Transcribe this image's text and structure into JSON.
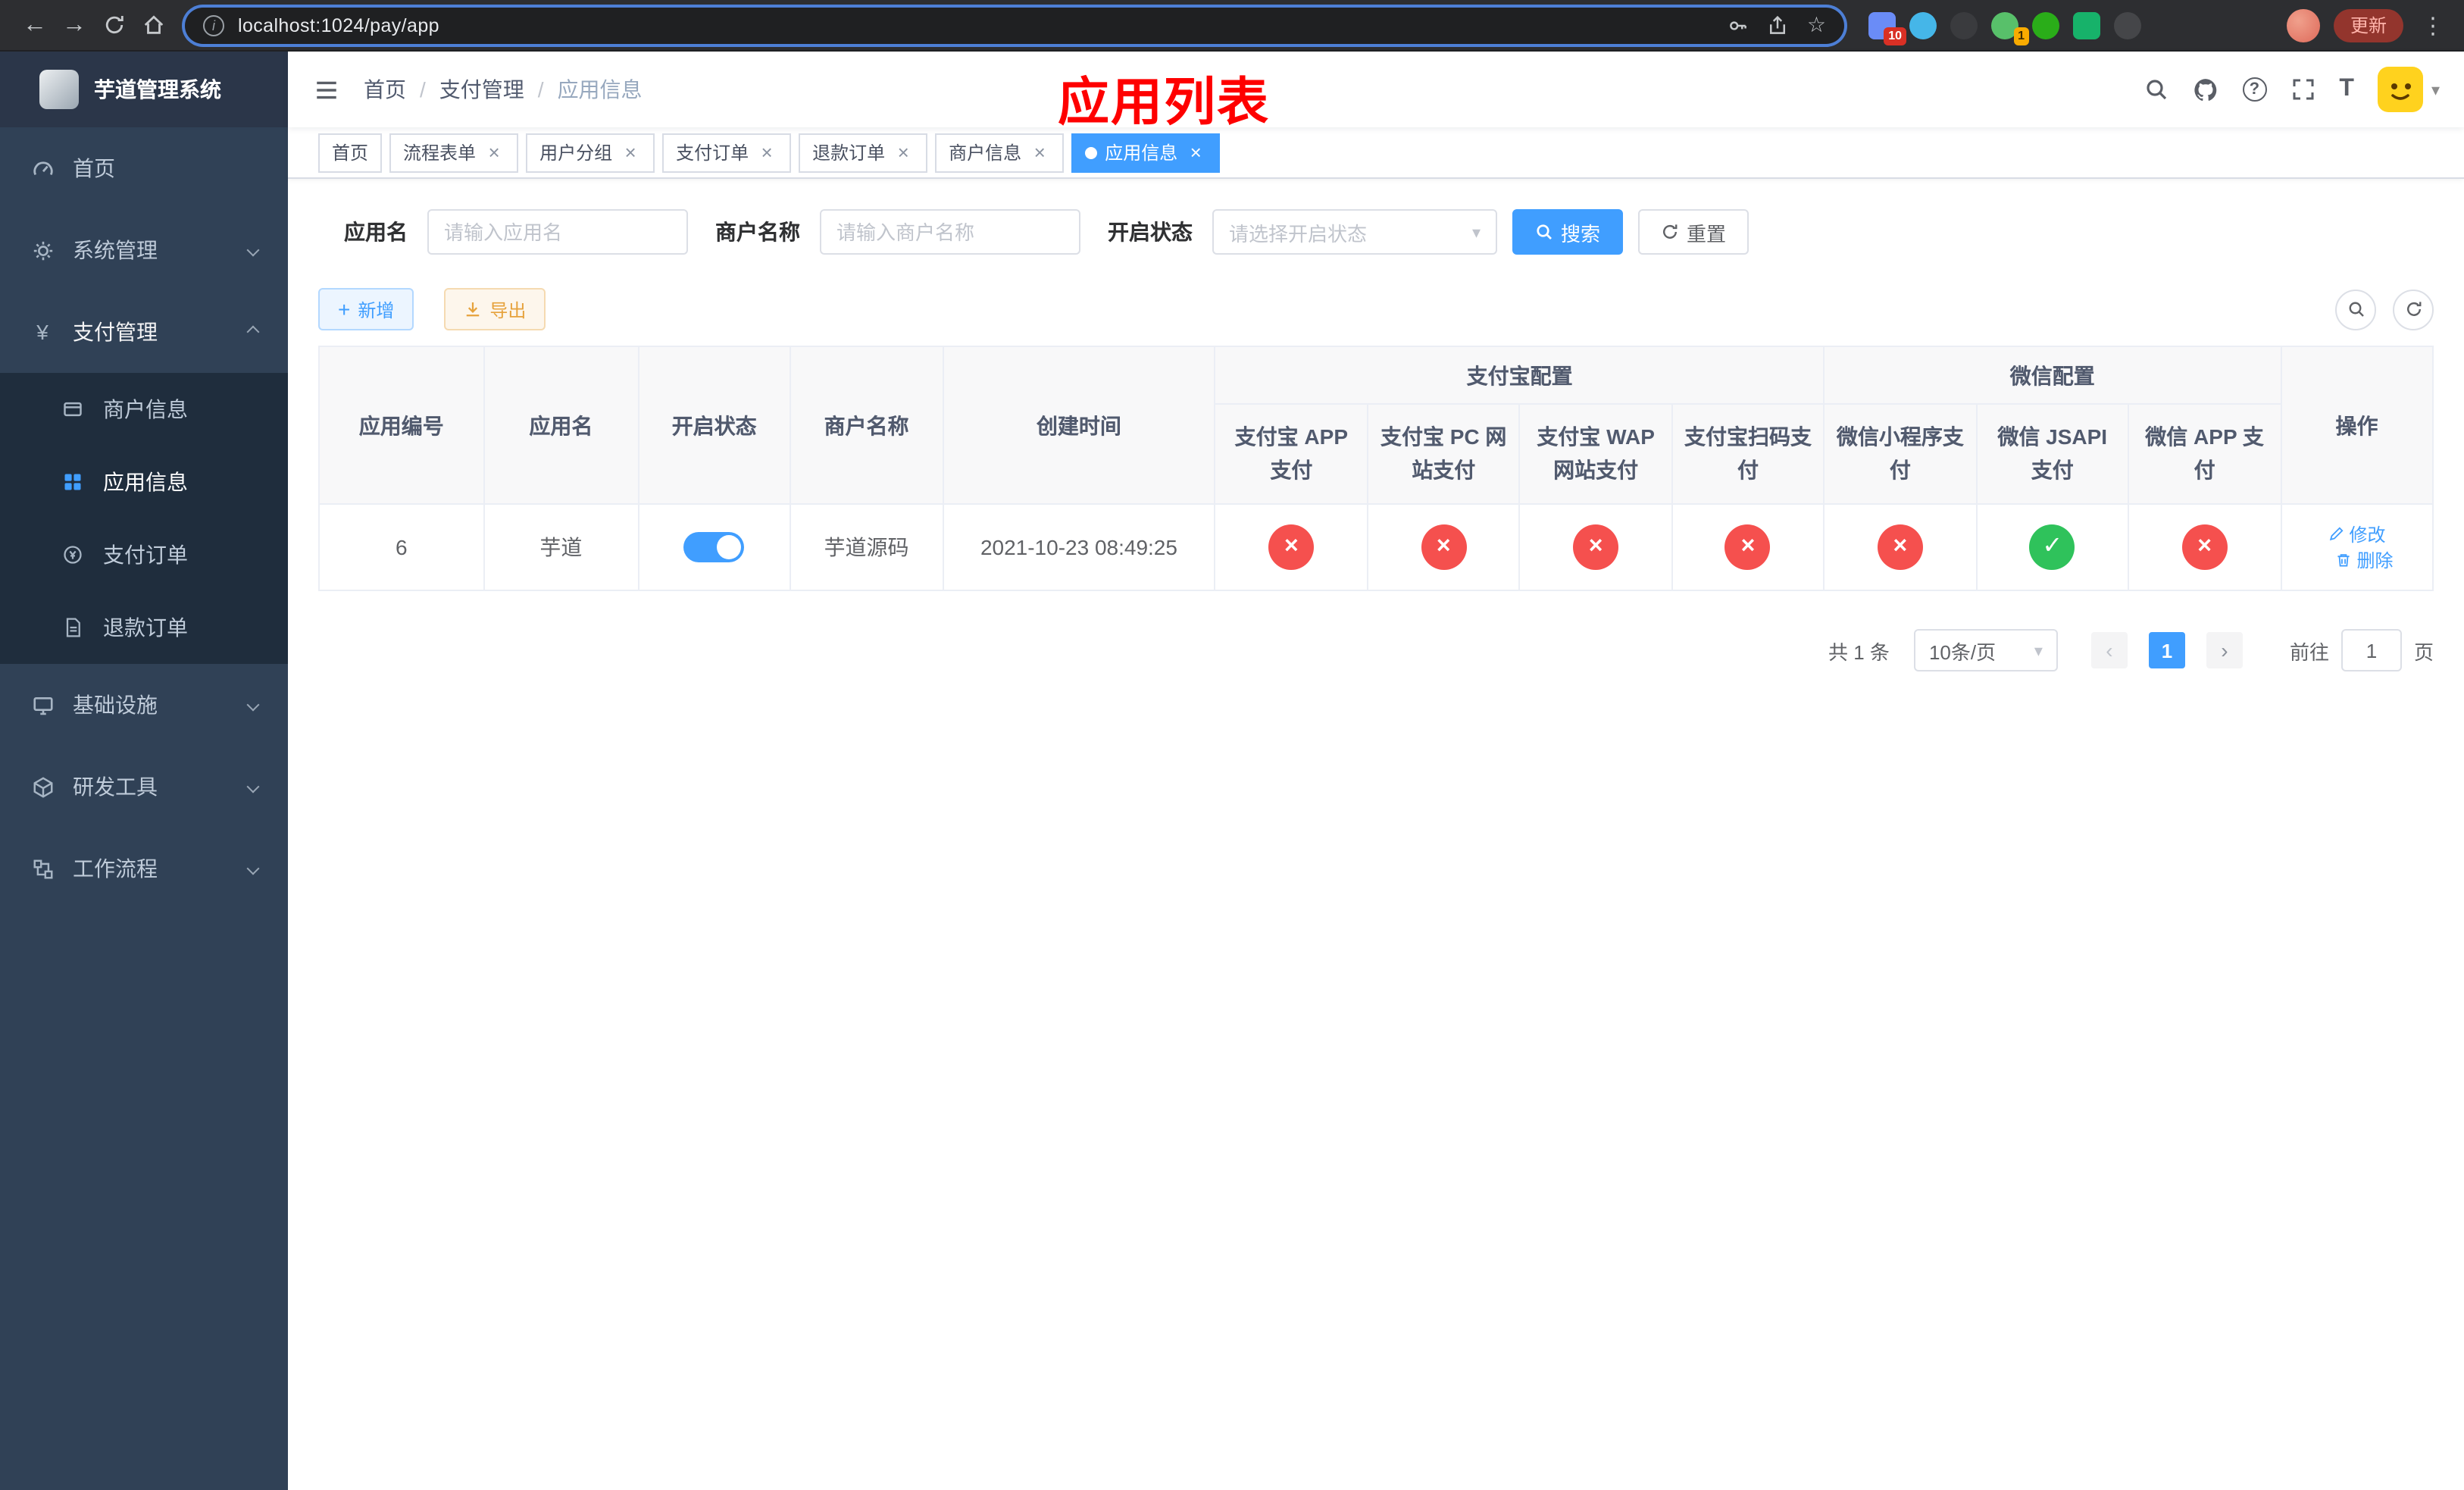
{
  "browser": {
    "url": "localhost:1024/pay/app",
    "update_label": "更新",
    "extension_badge_count": "10",
    "extension_badge_count_2": "1"
  },
  "icons": {
    "back": "←",
    "forward": "→",
    "star": "☆",
    "menu_dots": "⋮",
    "caret_down": "▾",
    "close": "×",
    "check": "✓",
    "cross": "×",
    "plus": "+",
    "yen": "¥",
    "info": "i",
    "question": "?",
    "font_size": "T",
    "slash": "/",
    "prev": "‹",
    "next": "›"
  },
  "sidebar": {
    "app_title": "芋道管理系统",
    "menu": [
      {
        "label": "首页"
      },
      {
        "label": "系统管理"
      },
      {
        "label": "支付管理"
      },
      {
        "label": "基础设施"
      },
      {
        "label": "研发工具"
      },
      {
        "label": "工作流程"
      }
    ],
    "submenu": [
      {
        "label": "商户信息"
      },
      {
        "label": "应用信息"
      },
      {
        "label": "支付订单"
      },
      {
        "label": "退款订单"
      }
    ]
  },
  "navbar": {
    "breadcrumb": [
      "首页",
      "支付管理",
      "应用信息"
    ],
    "annotation_title": "应用列表"
  },
  "tabs": [
    {
      "label": "首页",
      "closable": false,
      "active": false
    },
    {
      "label": "流程表单",
      "closable": true,
      "active": false
    },
    {
      "label": "用户分组",
      "closable": true,
      "active": false
    },
    {
      "label": "支付订单",
      "closable": true,
      "active": false
    },
    {
      "label": "退款订单",
      "closable": true,
      "active": false
    },
    {
      "label": "商户信息",
      "closable": true,
      "active": false
    },
    {
      "label": "应用信息",
      "closable": true,
      "active": true
    }
  ],
  "filters": {
    "app_name_label": "应用名",
    "app_name_placeholder": "请输入应用名",
    "app_name_value": "",
    "merchant_label": "商户名称",
    "merchant_placeholder": "请输入商户名称",
    "merchant_value": "",
    "status_label": "开启状态",
    "status_placeholder": "请选择开启状态",
    "search_label": "搜索",
    "reset_label": "重置"
  },
  "toolbar": {
    "add_label": "新增",
    "export_label": "导出"
  },
  "table": {
    "headers": {
      "app_id": "应用编号",
      "app_name": "应用名",
      "status": "开启状态",
      "merchant": "商户名称",
      "create_time": "创建时间",
      "alipay_group": "支付宝配置",
      "wechat_group": "微信配置",
      "actions": "操作",
      "alipay_app": "支付宝 APP 支付",
      "alipay_pc": "支付宝 PC 网站支付",
      "alipay_wap": "支付宝 WAP 网站支付",
      "alipay_qr": "支付宝扫码支付",
      "wechat_mini": "微信小程序支付",
      "wechat_jsapi": "微信 JSAPI 支付",
      "wechat_app": "微信 APP 支付"
    },
    "rows": [
      {
        "app_id": "6",
        "app_name": "芋道",
        "status_enabled": true,
        "merchant": "芋道源码",
        "create_time": "2021-10-23 08:49:25",
        "alipay_app": "disabled",
        "alipay_pc": "disabled",
        "alipay_wap": "disabled",
        "alipay_qr": "disabled",
        "wechat_mini": "disabled",
        "wechat_jsapi": "enabled",
        "wechat_app": "disabled",
        "edit_label": "修改",
        "delete_label": "删除"
      }
    ]
  },
  "pagination": {
    "total_label": "共 1 条",
    "page_size_label": "10条/页",
    "current_page": "1",
    "goto_label": "前往",
    "goto_value": "1",
    "page_unit": "页"
  },
  "colors": {
    "primary": "#409eff",
    "success": "#2fc25b",
    "danger": "#f5504e",
    "warning": "#e6a23c",
    "sidebar_bg": "#304156",
    "submenu_bg": "#1f2d3d",
    "annotation": "#fe0000",
    "chrome_bg": "#2d2e31"
  }
}
